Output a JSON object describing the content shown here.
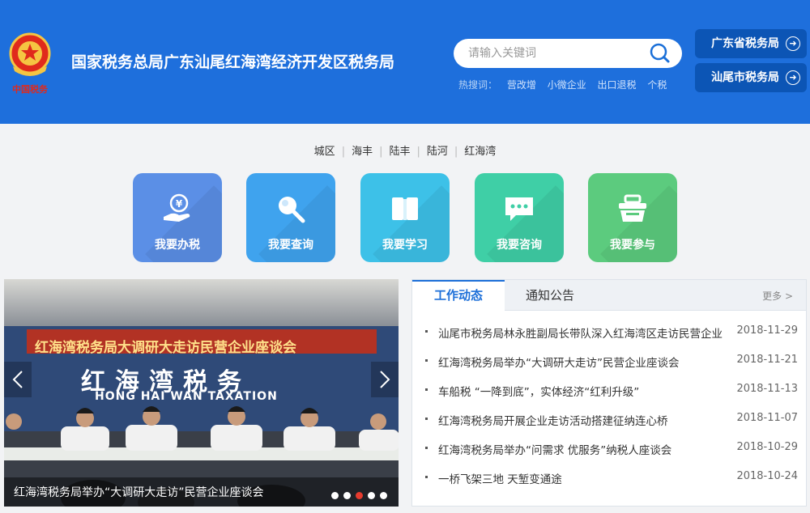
{
  "header": {
    "emblem_caption": "中国税务",
    "title": "国家税务总局广东汕尾红海湾经济开发区税务局",
    "search_placeholder": "请输入关键词",
    "hot_label": "热搜词：",
    "hot_words": [
      "营改增",
      "小微企业",
      "出口退税",
      "个税"
    ],
    "bureau_links": [
      {
        "label": "广东省税务局"
      },
      {
        "label": "汕尾市税务局"
      }
    ]
  },
  "regions": [
    "城区",
    "海丰",
    "陆丰",
    "陆河",
    "红海湾"
  ],
  "tiles": [
    {
      "label": "我要办税",
      "color": "#5b8fe6",
      "icon": "yuan-hand-icon"
    },
    {
      "label": "我要查询",
      "color": "#3fa3ee",
      "icon": "magnifier-icon"
    },
    {
      "label": "我要学习",
      "color": "#3dc1e8",
      "icon": "book-icon"
    },
    {
      "label": "我要咨询",
      "color": "#3fcfa6",
      "icon": "chat-bubble-icon"
    },
    {
      "label": "我要参与",
      "color": "#5ccb7e",
      "icon": "basket-icon"
    }
  ],
  "slider": {
    "banner_text": "红海湾税务局大调研大走访民营企业座谈会",
    "wall_title": "红海湾税务",
    "wall_subtitle": "HONG HAI WAN TAXATION",
    "caption": "红海湾税务局举办“大调研大走访”民营企业座谈会",
    "dot_count": 5,
    "active_dot": 2
  },
  "news": {
    "tabs": [
      "工作动态",
      "通知公告"
    ],
    "more": "更多 >",
    "items": [
      {
        "title": "汕尾市税务局林永胜副局长带队深入红海湾区走访民营企业",
        "date": "2018-11-29"
      },
      {
        "title": "红海湾税务局举办“大调研大走访”民营企业座谈会",
        "date": "2018-11-21"
      },
      {
        "title": "车船税 “一降到底”，实体经济“红利升级”",
        "date": "2018-11-13"
      },
      {
        "title": "红海湾税务局开展企业走访活动搭建征纳连心桥",
        "date": "2018-11-07"
      },
      {
        "title": "红海湾税务局举办“问需求 优服务”纳税人座谈会",
        "date": "2018-10-29"
      },
      {
        "title": "一桥飞架三地 天堑变通途",
        "date": "2018-10-24"
      }
    ]
  },
  "colors": {
    "header_blue": "#1e6fdc",
    "button_navy": "#0c55b5",
    "accent_red": "#e63b2e",
    "tab_blue": "#1d6fd8"
  }
}
